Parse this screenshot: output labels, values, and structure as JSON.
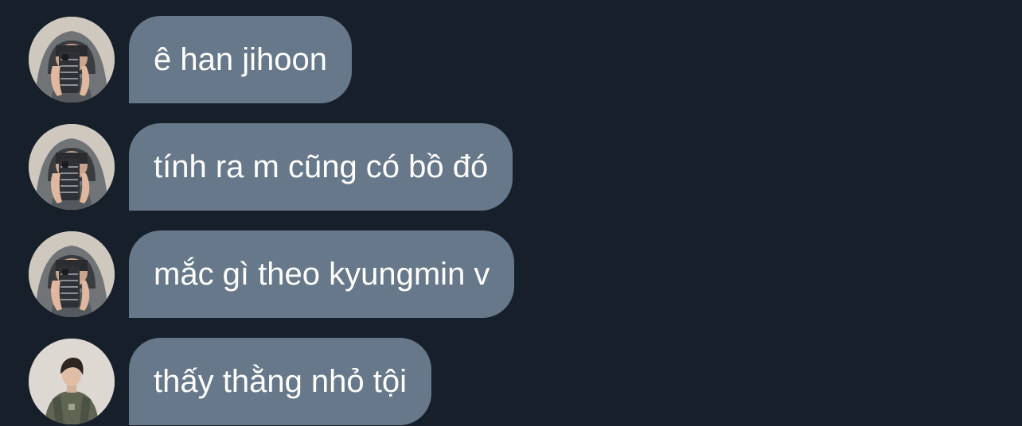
{
  "colors": {
    "background": "#17202a",
    "bubble": "#66788a",
    "text": "#ffffff"
  },
  "messages": [
    {
      "text": "ê han jihoon",
      "avatar": "hoodie-mirror-selfie"
    },
    {
      "text": "tính ra m cũng có bồ đó",
      "avatar": "hoodie-mirror-selfie"
    },
    {
      "text": "mắc gì theo kyungmin v",
      "avatar": "hoodie-mirror-selfie"
    },
    {
      "text": "thấy thằng nhỏ tội",
      "avatar": "boy-green-jacket"
    }
  ]
}
